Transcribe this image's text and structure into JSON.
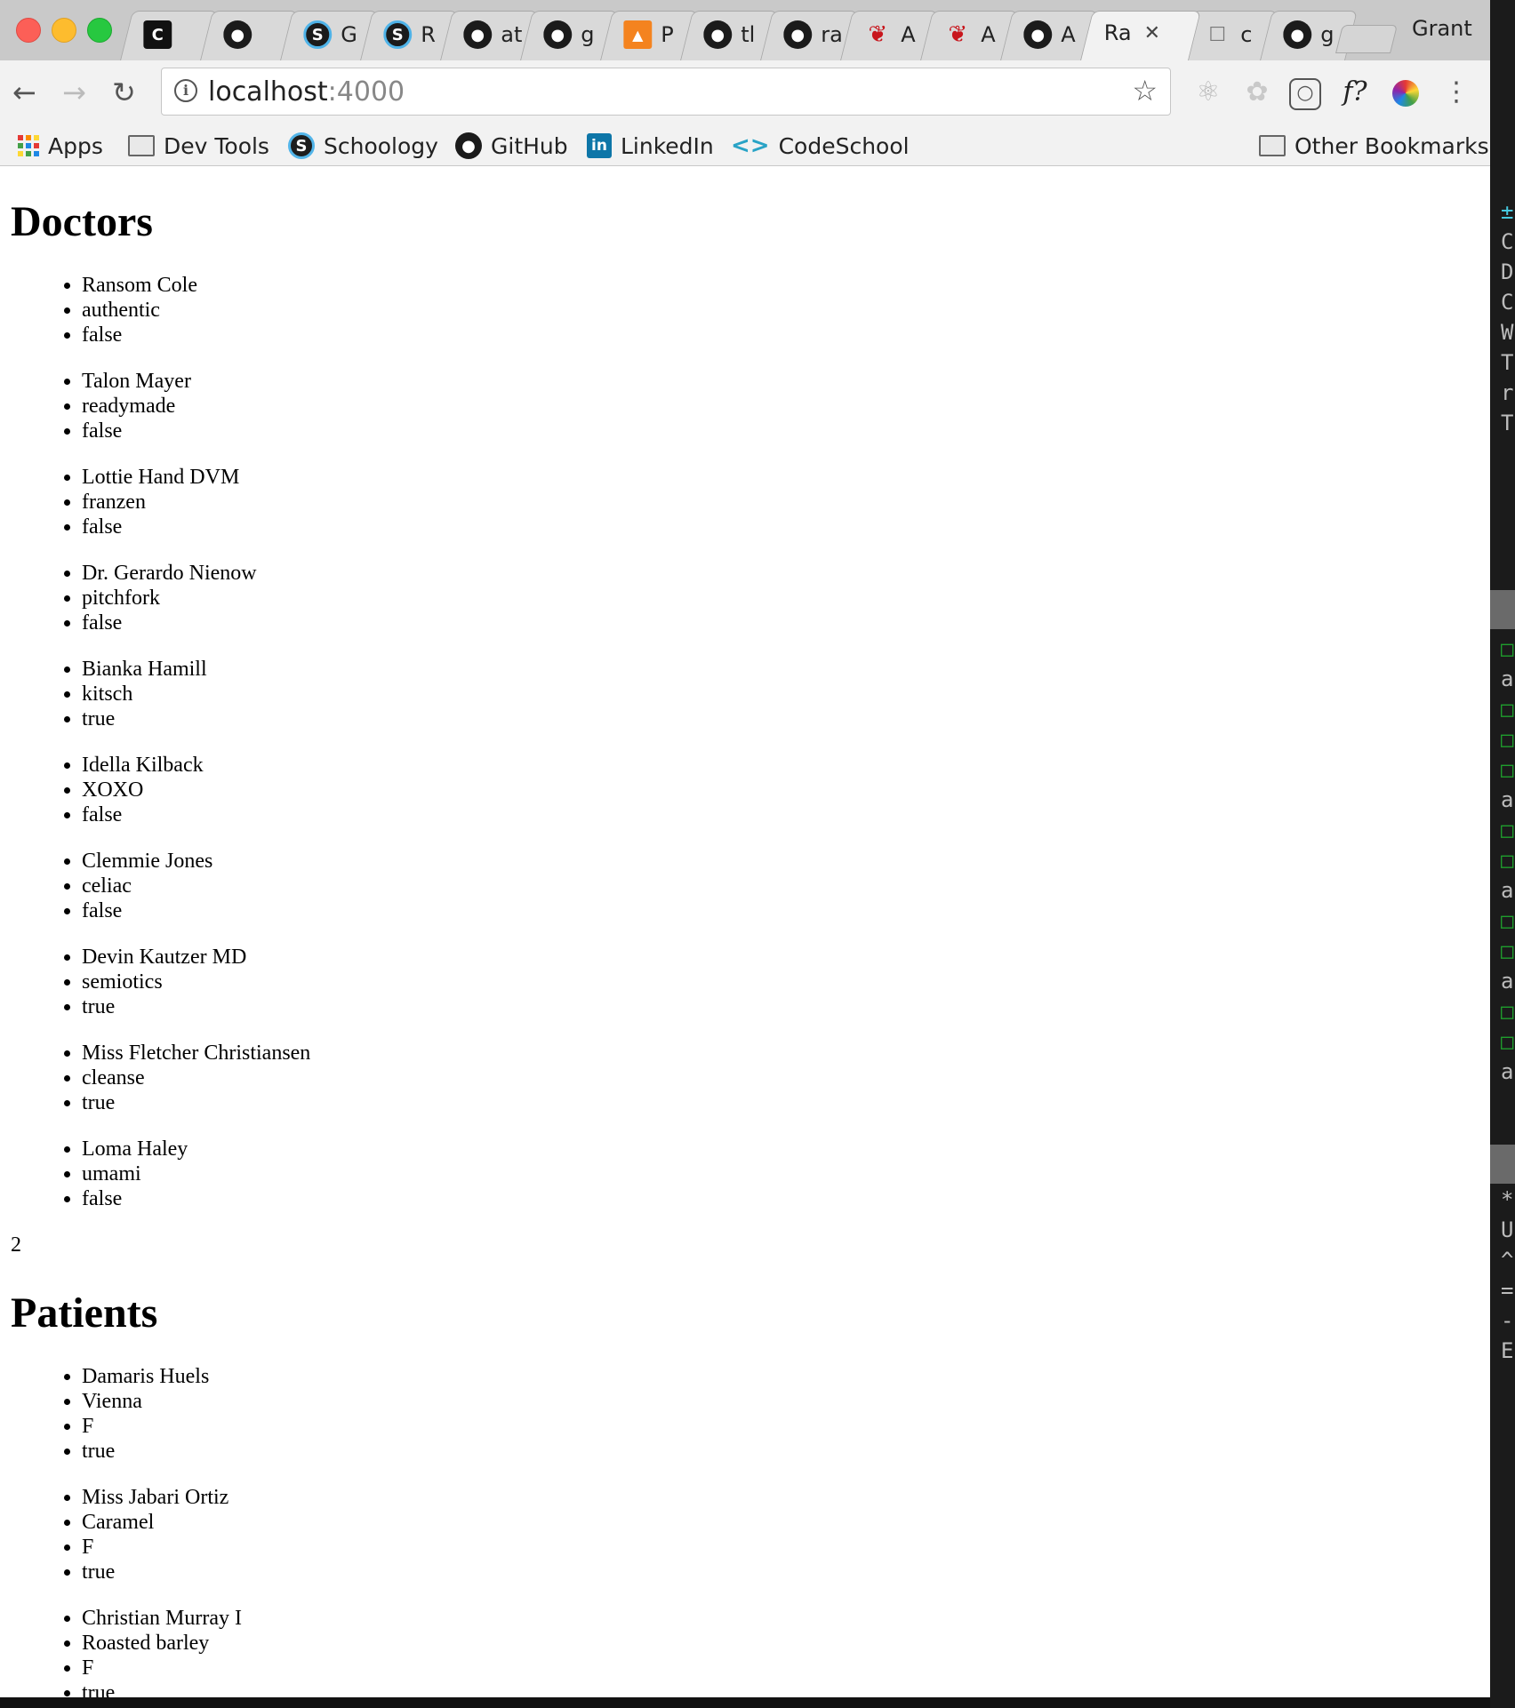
{
  "browser": {
    "tabs": [
      {
        "icon": "c-logo-icon",
        "glyph": "C",
        "title": ""
      },
      {
        "icon": "github-icon",
        "glyph": "",
        "title": ""
      },
      {
        "icon": "schoology-icon",
        "glyph": "S",
        "title": "G"
      },
      {
        "icon": "schoology-icon",
        "glyph": "S",
        "title": "R"
      },
      {
        "icon": "github-icon",
        "glyph": "",
        "title": "at"
      },
      {
        "icon": "github-icon",
        "glyph": "",
        "title": "g"
      },
      {
        "icon": "pitch-icon",
        "glyph": "",
        "title": "P"
      },
      {
        "icon": "github-icon",
        "glyph": "",
        "title": "tl"
      },
      {
        "icon": "github-icon",
        "glyph": "",
        "title": "ra"
      },
      {
        "icon": "rails-icon",
        "glyph": "",
        "title": "A"
      },
      {
        "icon": "rails-icon",
        "glyph": "",
        "title": "A"
      },
      {
        "icon": "github-icon",
        "glyph": "",
        "title": "A"
      },
      {
        "icon": "",
        "glyph": "",
        "title": "Ra",
        "active": true
      },
      {
        "icon": "document-icon",
        "glyph": "",
        "title": "c"
      },
      {
        "icon": "github-icon",
        "glyph": "",
        "title": "g"
      }
    ],
    "profile_name": "Grant",
    "url_host": "localhost",
    "url_port": ":4000",
    "bookmarks": {
      "apps": "Apps",
      "dev_tools": "Dev Tools",
      "schoology": "Schoology",
      "github": "GitHub",
      "linkedin": "LinkedIn",
      "codeschool": "CodeSchool",
      "other": "Other Bookmarks"
    },
    "colors": {
      "tab_bar": "#c9c9c9",
      "toolbar": "#f2f2f2",
      "close": "#fc5f57",
      "minimize": "#fdbc2e",
      "maximize": "#27c840"
    }
  },
  "page": {
    "doctors_heading": "Doctors",
    "doctors": [
      [
        "Ransom Cole",
        "authentic",
        "false"
      ],
      [
        "Talon Mayer",
        "readymade",
        "false"
      ],
      [
        "Lottie Hand DVM",
        "franzen",
        "false"
      ],
      [
        "Dr. Gerardo Nienow",
        "pitchfork",
        "false"
      ],
      [
        "Bianka Hamill",
        "kitsch",
        "true"
      ],
      [
        "Idella Kilback",
        "XOXO",
        "false"
      ],
      [
        "Clemmie Jones",
        "celiac",
        "false"
      ],
      [
        "Devin Kautzer MD",
        "semiotics",
        "true"
      ],
      [
        "Miss Fletcher Christiansen",
        "cleanse",
        "true"
      ],
      [
        "Loma Haley",
        "umami",
        "false"
      ]
    ],
    "count_value": "2",
    "patients_heading": "Patients",
    "patients": [
      [
        "Damaris Huels",
        "Vienna",
        "F",
        "true"
      ],
      [
        "Miss Jabari Ortiz",
        "Caramel",
        "F",
        "true"
      ],
      [
        "Christian Murray I",
        "Roasted barley",
        "F",
        "true"
      ]
    ]
  },
  "terminal": {
    "lines_top": [
      "±",
      "C",
      "D",
      "C",
      "W",
      "T",
      "r",
      "T"
    ],
    "lines_mid": [
      "□",
      "a",
      "□",
      "□",
      "□",
      "a",
      "□",
      "□",
      "a",
      "□",
      "□",
      "a",
      "□",
      "□",
      "a"
    ],
    "lines_bot": [
      "*",
      "U",
      "^",
      "=",
      "-",
      "E"
    ]
  }
}
